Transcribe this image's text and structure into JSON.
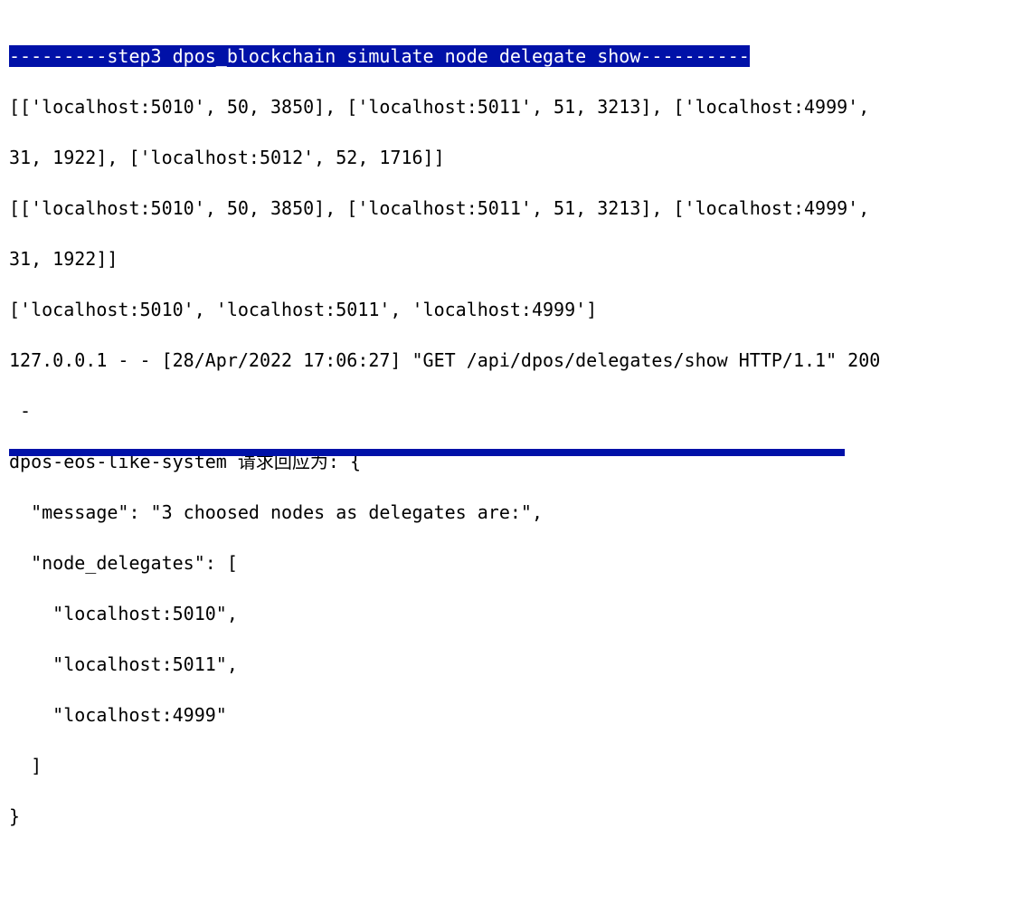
{
  "terminal": {
    "lines": [
      "---------step3 dpos_blockchain simulate node delegate show----------",
      "[['localhost:5010', 50, 3850], ['localhost:5011', 51, 3213], ['localhost:4999',",
      "31, 1922], ['localhost:5012', 52, 1716]]",
      "[['localhost:5010', 50, 3850], ['localhost:5011', 51, 3213], ['localhost:4999',",
      "31, 1922]]",
      "['localhost:5010', 'localhost:5011', 'localhost:4999']",
      "127.0.0.1 - - [28/Apr/2022 17:06:27] \"GET /api/dpos/delegates/show HTTP/1.1\" 200",
      " -",
      "dpos-eos-like-system 请求回应为: {",
      "  \"message\": \"3 choosed nodes as delegates are:\",",
      "  \"node_delegates\": [",
      "    \"localhost:5010\",",
      "    \"localhost:5011\",",
      "    \"localhost:4999\"",
      "  ]",
      "}",
      ""
    ]
  },
  "colors": {
    "highlight_background": "#0011a8",
    "highlight_text": "#ffffff",
    "text": "#000000",
    "background": "#ffffff"
  }
}
